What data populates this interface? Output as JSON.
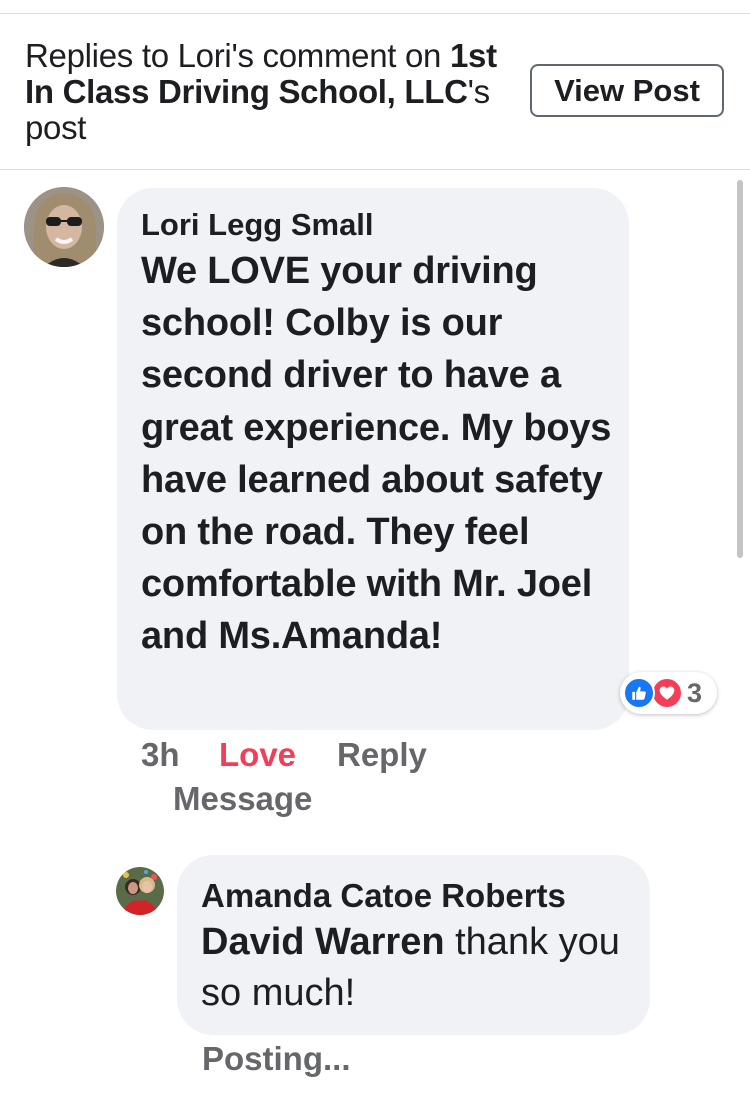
{
  "header": {
    "title_part1": "Replies to Lori's comment on ",
    "title_page": "1st In Class Driving School, LLC",
    "title_part2": "'s post",
    "view_post_label": "View Post"
  },
  "comment": {
    "author": "Lori Legg Small",
    "text": "We LOVE your driving school! Colby is our second driver to have a great experience. My boys have learned about safety on the road. They feel comfortable with Mr. Joel and Ms.Amanda!",
    "reactions": {
      "icons": [
        "like-icon",
        "love-icon"
      ],
      "count": "3"
    },
    "actions": {
      "time": "3h",
      "love": "Love",
      "reply": "Reply",
      "message": "Message"
    }
  },
  "reply": {
    "author": "Amanda Catoe Roberts",
    "mention": "David Warren",
    "text": " thank you so much!",
    "status": "Posting..."
  },
  "colors": {
    "love_accent": "#f33e58",
    "like_accent": "#1877f2",
    "bubble_bg": "#f0f2f5",
    "meta_text": "#65676b"
  }
}
